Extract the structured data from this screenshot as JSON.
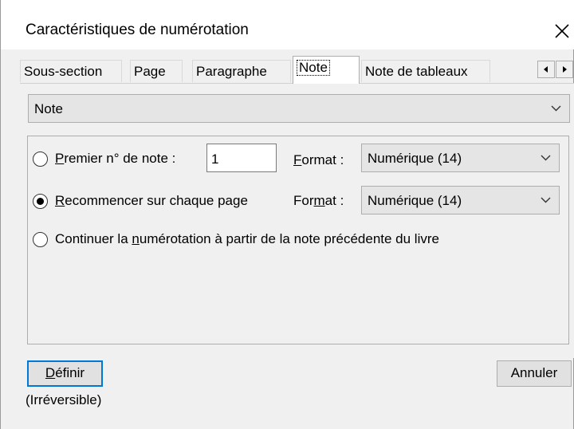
{
  "window": {
    "title": "Caractéristiques de numérotation",
    "close_glyph": "close-icon"
  },
  "tabs": [
    {
      "label": "Sous-section",
      "active": false
    },
    {
      "label": "Page",
      "active": false
    },
    {
      "label": "Paragraphe",
      "active": false
    },
    {
      "label": "Note",
      "active": true
    },
    {
      "label": "Note de tableaux",
      "active": false
    }
  ],
  "tab_scroll": {
    "left": "scroll-left-icon",
    "right": "scroll-right-icon"
  },
  "type_select": {
    "value": "Note"
  },
  "options": {
    "first_number": {
      "label_pre": "",
      "label_accel": "P",
      "label_post": "remier n° de note :",
      "value": "1",
      "selected": false,
      "format_pre": "",
      "format_accel": "F",
      "format_post": "ormat :",
      "format_value": "Numérique (14)"
    },
    "restart_each_page": {
      "label_pre": "",
      "label_accel": "R",
      "label_post": "ecommencer sur chaque page",
      "selected": true,
      "format_pre": "For",
      "format_accel": "m",
      "format_post": "at :",
      "format_value": "Numérique (14)"
    },
    "continue": {
      "label_pre": "Continuer la ",
      "label_accel": "n",
      "label_post": "umérotation à partir de la note précédente du livre",
      "selected": false
    }
  },
  "buttons": {
    "define_accel": "D",
    "define_rest": "éfinir",
    "cancel": "Annuler"
  },
  "note": "(Irréversible)",
  "colors": {
    "focus_border": "#0078d7",
    "title_bg": "#ffffff",
    "dialog_bg": "#f0f0f0"
  }
}
